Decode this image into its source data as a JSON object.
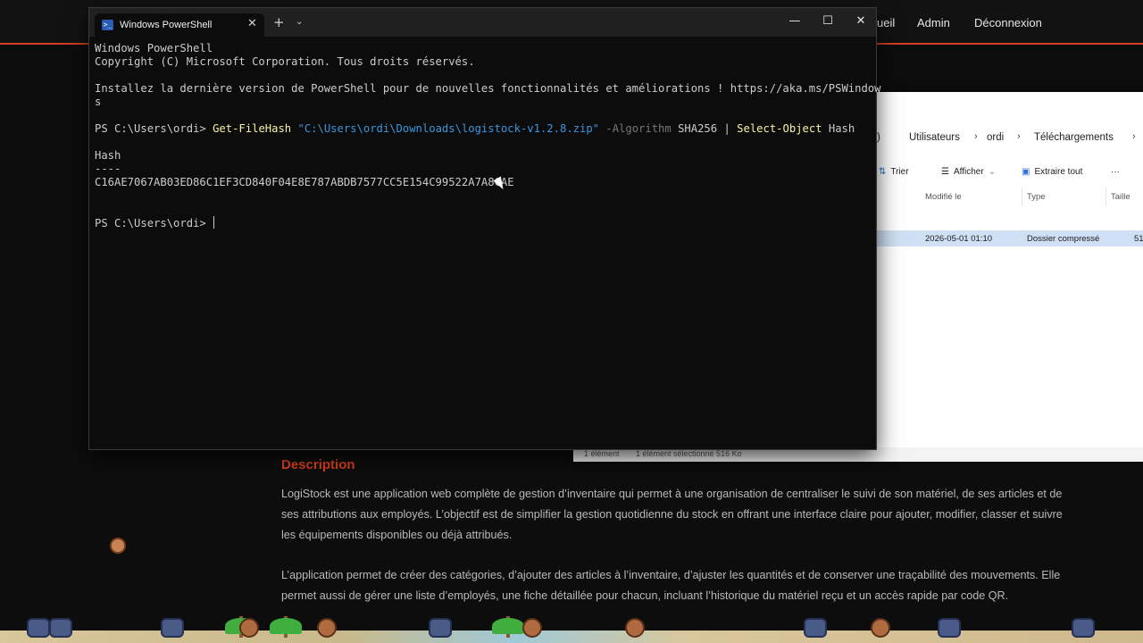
{
  "site": {
    "nav": [
      "ueil",
      "Admin",
      "Déconnexion"
    ],
    "description": {
      "title": "Description",
      "paragraph1": "LogiStock est une application web complète de gestion d’inventaire qui permet à une organisation de centraliser le suivi de son matériel, de ses articles et de ses attributions aux employés. L’objectif est de simplifier la gestion quotidienne du stock en offrant une interface claire pour ajouter, modifier, classer et suivre les équipements disponibles ou déjà attribués.",
      "paragraph2": "L’application permet de créer des catégories, d’ajouter des articles à l’inventaire, d’ajuster les quantités et de conserver une traçabilité des mouvements. Elle permet aussi de gérer une liste d’employés, une fiche détaillée pour chacun, incluant l’historique du matériel reçu et un accès rapide par code QR."
    }
  },
  "explorer": {
    "breadcrumb": [
      ")",
      "Utilisateurs",
      "ordi",
      "Téléchargements"
    ],
    "toolbar": {
      "sort": "Trier",
      "view": "Afficher",
      "extract": "Extraire tout",
      "more": "···"
    },
    "columns": {
      "modified": "Modifié le",
      "type": "Type",
      "size": "Taille"
    },
    "row": {
      "modified": "2026-05-01 01:10",
      "type": "Dossier compressé",
      "size": "51"
    },
    "status": {
      "count": "1 élément",
      "selected": "1 élément sélectionné  516 Ko"
    }
  },
  "powershell": {
    "tab_title": "Windows PowerShell",
    "window_controls": {
      "minimize": "—",
      "maximize": "☐",
      "close": "✕"
    },
    "header_line1": "Windows PowerShell",
    "header_line2": "Copyright (C) Microsoft Corporation. Tous droits réservés.",
    "install_line1": "Installez la dernière version de PowerShell pour de nouvelles fonctionnalités et améliorations ! https://aka.ms/PSWindow",
    "install_line2": "s",
    "prompt": "PS C:\\Users\\ordi> ",
    "cmd_name": "Get-FileHash",
    "cmd_path": "\"C:\\Users\\ordi\\Downloads\\logistock-v1.2.8.zip\"",
    "cmd_param": "-Algorithm",
    "cmd_algo": "SHA256",
    "cmd_pipe": "|",
    "cmd_select": "Select-Object",
    "cmd_select_arg": "Hash",
    "output_header": "Hash",
    "output_rule": "----",
    "hash_value": "C16AE7067AB03ED86C1EF3CD840F04E8E787ABDB7577CC5E154C99522A7A8CAE",
    "prompt2": "PS C:\\Users\\ordi> "
  },
  "colors": {
    "accent": "#d0401e",
    "ps_background": "#0c0c0c",
    "ps_command": "#f9f1a5",
    "ps_string": "#3a96dd"
  }
}
